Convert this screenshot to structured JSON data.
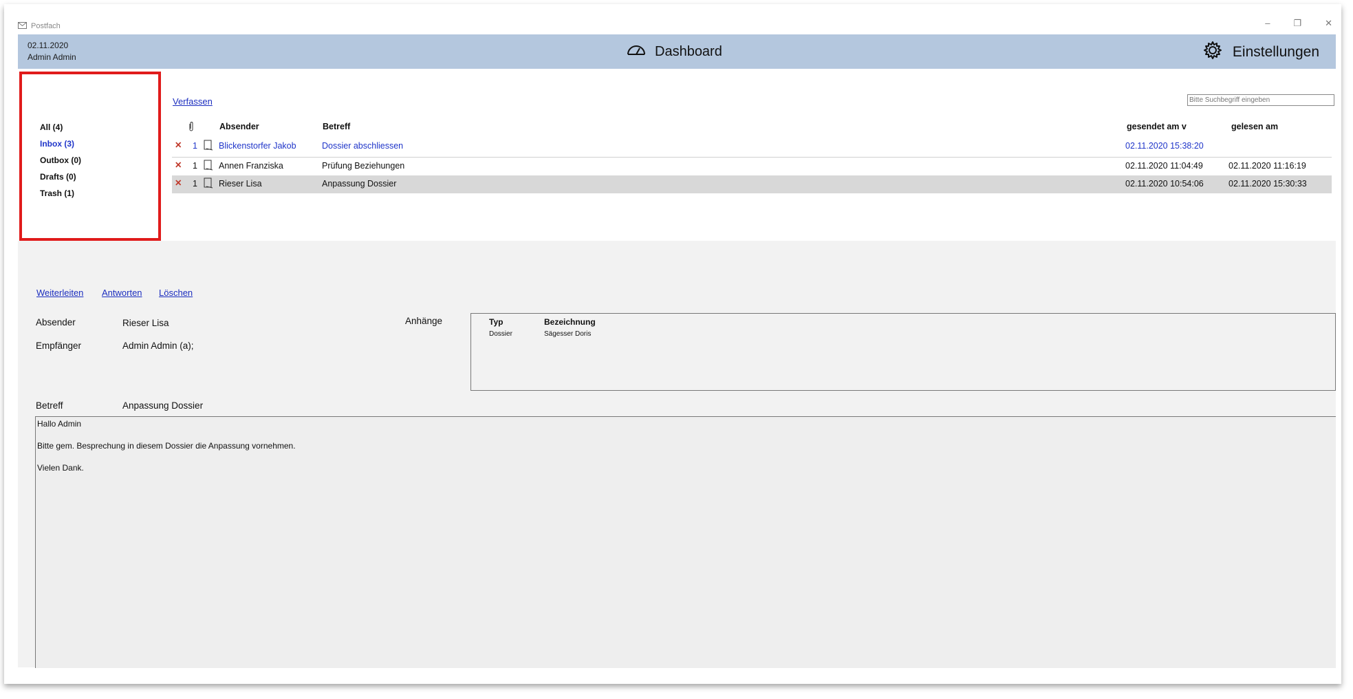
{
  "window": {
    "title": "Postfach",
    "controls": [
      "–",
      "❐",
      "✕"
    ]
  },
  "header": {
    "date": "02.11.2020",
    "user": "Admin Admin",
    "dashboard_label": "Dashboard",
    "settings_label": "Einstellungen"
  },
  "folders": [
    {
      "label": "All (4)",
      "active": false
    },
    {
      "label": "Inbox (3)",
      "active": true
    },
    {
      "label": "Outbox (0)",
      "active": false
    },
    {
      "label": "Drafts (0)",
      "active": false
    },
    {
      "label": "Trash (1)",
      "active": false
    }
  ],
  "list": {
    "compose_label": "Verfassen",
    "search_placeholder": "Bitte Suchbegriff eingeben",
    "columns": {
      "sender": "Absender",
      "subject": "Betreff",
      "sent": "gesendet am v",
      "read": "gelesen am"
    },
    "rows": [
      {
        "count": "1",
        "sender": "Blickenstorfer Jakob",
        "subject": "Dossier abschliessen",
        "sent": "02.11.2020 15:38:20",
        "read": "",
        "unread": true,
        "selected": false
      },
      {
        "count": "1",
        "sender": "Annen Franziska",
        "subject": "Prüfung Beziehungen",
        "sent": "02.11.2020 11:04:49",
        "read": "02.11.2020 11:16:19",
        "unread": false,
        "selected": false
      },
      {
        "count": "1",
        "sender": "Rieser Lisa",
        "subject": "Anpassung Dossier",
        "sent": "02.11.2020 10:54:06",
        "read": "02.11.2020 15:30:33",
        "unread": false,
        "selected": true
      }
    ]
  },
  "detail": {
    "actions": {
      "forward": "Weiterleiten",
      "reply": "Antworten",
      "delete": "Löschen"
    },
    "sender_label": "Absender",
    "sender_value": "Rieser Lisa",
    "recipient_label": "Empfänger",
    "recipient_value": "Admin Admin (a);",
    "attachments_label": "Anhänge",
    "attachments": {
      "col_type": "Typ",
      "col_name": "Bezeichnung",
      "items": [
        {
          "type": "Dossier",
          "name": "Sägesser Doris"
        }
      ]
    },
    "subject_label": "Betreff",
    "subject_value": "Anpassung Dossier",
    "body": [
      "Hallo Admin",
      "Bitte gem. Besprechung in diesem Dossier die Anpassung vornehmen.",
      "Vielen Dank."
    ]
  },
  "colors": {
    "header_bg": "#b4c7de",
    "highlight_border": "#e01b1b",
    "link": "#1b2dbf",
    "delete_icon": "#c0392b"
  }
}
